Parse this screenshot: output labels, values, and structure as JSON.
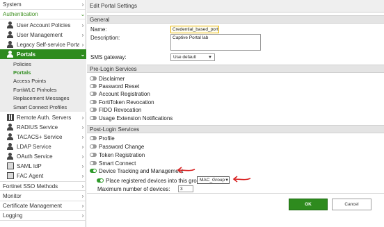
{
  "sidebar": {
    "system": "System",
    "authentication": "Authentication",
    "user_account_policies": "User Account Policies",
    "user_management": "User Management",
    "legacy_portal": "Legacy Self-service Portal",
    "portals": "Portals",
    "portals_children": {
      "policies": "Policies",
      "portals": "Portals",
      "access_points": "Access Points",
      "fortiwlc_pinholes": "FortiWLC Pinholes",
      "replacement_messages": "Replacement Messages",
      "smart_connect_profiles": "Smart Connect Profiles"
    },
    "remote_auth_servers": "Remote Auth. Servers",
    "radius_service": "RADIUS Service",
    "tacacs_service": "TACACS+ Service",
    "ldap_service": "LDAP Service",
    "oauth_service": "OAuth Service",
    "saml_idp": "SAML IdP",
    "fac_agent": "FAC Agent",
    "fortinet_sso": "Fortinet SSO Methods",
    "monitor": "Monitor",
    "certificate_management": "Certificate Management",
    "logging": "Logging"
  },
  "main": {
    "title": "Edit Portal Settings",
    "general": {
      "heading": "General",
      "name_label": "Name:",
      "name_value": "Credential_based_portal_",
      "description_label": "Description:",
      "description_value": "Captive Portal lab",
      "sms_label": "SMS gateway:",
      "sms_value": "Use default"
    },
    "pre_login": {
      "heading": "Pre-Login Services",
      "items": [
        "Disclaimer",
        "Password Reset",
        "Account Registration",
        "FortiToken Revocation",
        "FIDO Revocation",
        "Usage Extension Notifications"
      ]
    },
    "post_login": {
      "heading": "Post-Login Services",
      "items": [
        "Profile",
        "Password Change",
        "Token Registration",
        "Smart Connect",
        "Device Tracking and Management"
      ],
      "place_registered_label": "Place registered devices into this group",
      "group_value": "MAC_Group",
      "max_devices_label": "Maximum number of devices:",
      "max_devices_value": "3"
    },
    "ok_label": "OK",
    "cancel_label": "Cancel"
  },
  "colors": {
    "accent_green": "#2e8b1e",
    "annotation_red": "#d81e1e"
  }
}
